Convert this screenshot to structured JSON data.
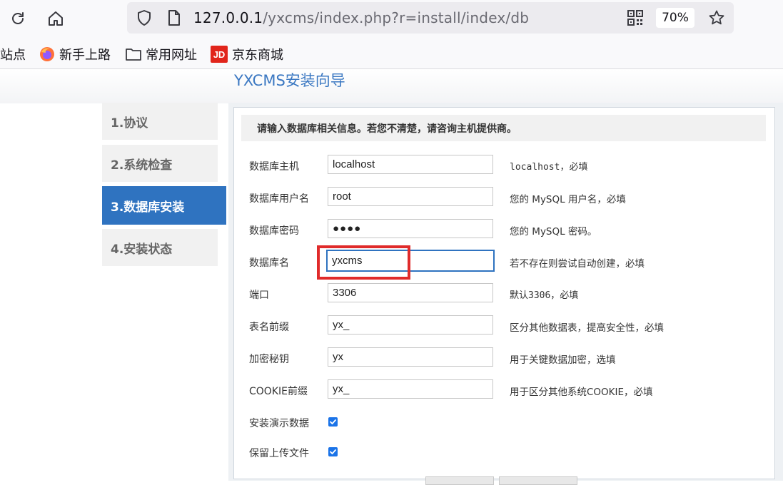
{
  "browser": {
    "url_host": "127.0.0.1",
    "url_path": "/yxcms/index.php?r=install/index/db",
    "zoom": "70%",
    "icons": [
      "reload-icon",
      "home-icon",
      "shield-icon",
      "page-icon",
      "qr-code-icon",
      "star-icon"
    ]
  },
  "bookmarks": [
    {
      "label": "站点",
      "icon": ""
    },
    {
      "label": "新手上路",
      "icon": "firefox-icon"
    },
    {
      "label": "常用网址",
      "icon": "folder-icon"
    },
    {
      "label": "京东商城",
      "icon": "jd-logo-icon"
    }
  ],
  "jd_logo_text": "JD",
  "page": {
    "title": "YXCMS安装向导",
    "steps": [
      {
        "label": "1.协议",
        "active": false
      },
      {
        "label": "2.系统检查",
        "active": false
      },
      {
        "label": "3.数据库安装",
        "active": true
      },
      {
        "label": "4.安装状态",
        "active": false
      }
    ],
    "notice": "请输入数据库相关信息。若您不清楚，请咨询主机提供商。",
    "fields": [
      {
        "label": "数据库主机",
        "value": "localhost",
        "hint": "localhost，必填"
      },
      {
        "label": "数据库用户名",
        "value": "root",
        "hint": "您的 MySQL 用户名，必填"
      },
      {
        "label": "数据库密码",
        "value": "●●●●",
        "hint": "您的 MySQL 密码。"
      },
      {
        "label": "数据库名",
        "value": "yxcms",
        "hint": "若不存在则尝试自动创建，必填"
      },
      {
        "label": "端口",
        "value": "3306",
        "hint": "默认3306，必填"
      },
      {
        "label": "表名前缀",
        "value": "yx_",
        "hint": "区分其他数据表，提高安全性，必填"
      },
      {
        "label": "加密秘钥",
        "value": "yx",
        "hint": "用于关键数据加密，选填"
      },
      {
        "label": "COOKIE前缀",
        "value": "yx_",
        "hint": "用于区分其他系统COOKIE，必填"
      }
    ],
    "checkboxes": [
      {
        "label": "安装演示数据",
        "checked": true
      },
      {
        "label": "保留上传文件",
        "checked": true
      }
    ]
  },
  "colors": {
    "accent": "#2f73c0",
    "highlight": "#e02b2b",
    "checkbox": "#1a73e8"
  }
}
